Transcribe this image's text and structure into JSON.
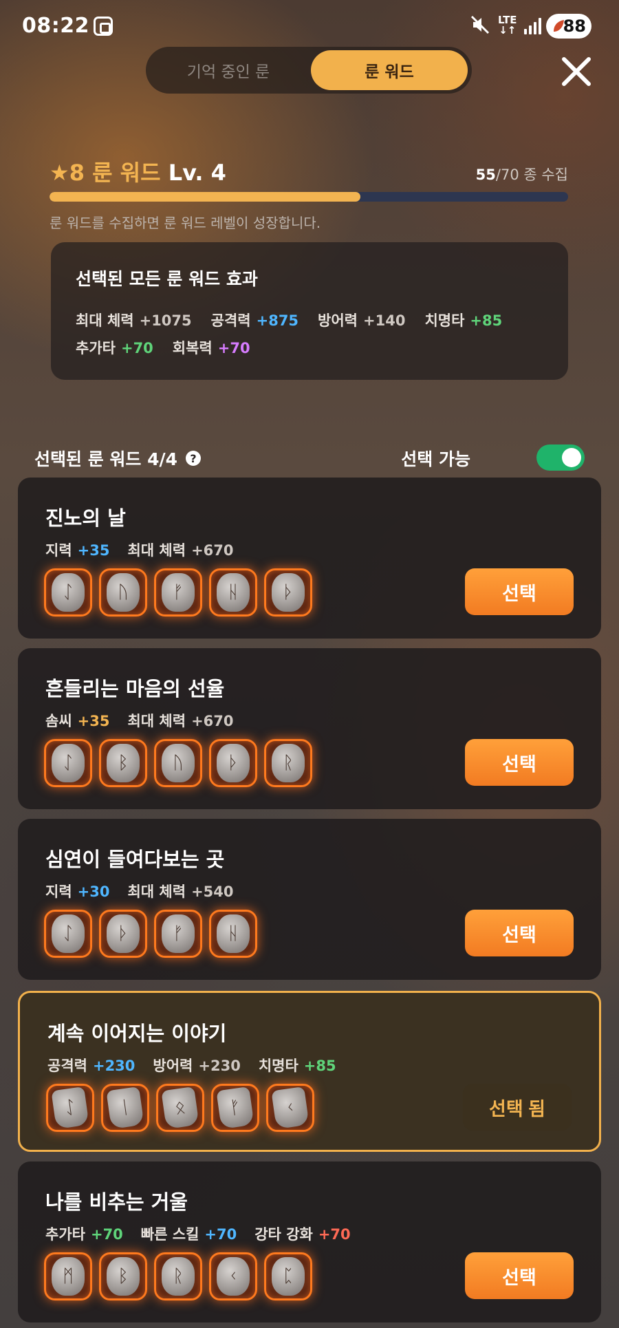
{
  "status_bar": {
    "time": "08:22",
    "network": "LTE",
    "battery": "88"
  },
  "tabs": [
    {
      "label": "기억 중인 룬",
      "active": false
    },
    {
      "label": "룬 워드",
      "active": true
    }
  ],
  "level": {
    "star": "★8",
    "name": "룬 워드",
    "level_label": "Lv. 4",
    "collected": "55",
    "total": "/70",
    "collect_suffix": " 종 수집",
    "progress_fraction": 0.6,
    "description": "룬 워드를 수집하면 룬 워드 레벨이 성장합니다."
  },
  "effects": {
    "title": "선택된 모든 룬 워드 효과",
    "stats": [
      {
        "name": "최대 체력",
        "value": "+1075",
        "color": "gray"
      },
      {
        "name": "공격력",
        "value": "+875",
        "color": "blue"
      },
      {
        "name": "방어력",
        "value": "+140",
        "color": "gray"
      },
      {
        "name": "치명타",
        "value": "+85",
        "color": "green"
      },
      {
        "name": "추가타",
        "value": "+70",
        "color": "green"
      },
      {
        "name": "회복력",
        "value": "+70",
        "color": "purple"
      }
    ]
  },
  "selected_header": {
    "label": "선택된 룬 워드 4/4",
    "help": "?"
  },
  "toggle": {
    "label": "선택 가능",
    "on": true
  },
  "cards": [
    {
      "title": "진노의 날",
      "stats": [
        {
          "name": "지력",
          "value": "+35",
          "color": "blue"
        },
        {
          "name": "최대 체력",
          "value": "+670",
          "color": "gray"
        }
      ],
      "runes": [
        "ᛇ",
        "ᚢ",
        "ᚠ",
        "ᚺ",
        "ᚦ"
      ],
      "button": "선택",
      "selected": false
    },
    {
      "title": "흔들리는 마음의 선율",
      "stats": [
        {
          "name": "솜씨",
          "value": "+35",
          "color": "gold"
        },
        {
          "name": "최대 체력",
          "value": "+670",
          "color": "gray"
        }
      ],
      "runes": [
        "ᛇ",
        "ᛒ",
        "ᚢ",
        "ᚦ",
        "ᚱ"
      ],
      "button": "선택",
      "selected": false
    },
    {
      "title": "심연이 들여다보는 곳",
      "stats": [
        {
          "name": "지력",
          "value": "+30",
          "color": "blue"
        },
        {
          "name": "최대 체력",
          "value": "+540",
          "color": "gray"
        }
      ],
      "runes": [
        "ᛇ",
        "ᚦ",
        "ᚠ",
        "ᚺ"
      ],
      "button": "선택",
      "selected": false
    },
    {
      "title": "계속 이어지는 이야기",
      "stats": [
        {
          "name": "공격력",
          "value": "+230",
          "color": "blue"
        },
        {
          "name": "방어력",
          "value": "+230",
          "color": "gray"
        },
        {
          "name": "치명타",
          "value": "+85",
          "color": "green"
        }
      ],
      "runes": [
        "ᛇ",
        "ᛁ",
        "ᛟ",
        "ᚠ",
        "ᚲ"
      ],
      "button": "선택 됨",
      "selected": true
    },
    {
      "title": "나를 비추는 거울",
      "stats": [
        {
          "name": "추가타",
          "value": "+70",
          "color": "green"
        },
        {
          "name": "빠른 스킬",
          "value": "+70",
          "color": "blue"
        },
        {
          "name": "강타 강화",
          "value": "+70",
          "color": "red"
        }
      ],
      "runes": [
        "ᛗ",
        "ᛒ",
        "ᚱ",
        "ᚲ",
        "ᛈ"
      ],
      "button": "선택",
      "selected": false
    }
  ]
}
